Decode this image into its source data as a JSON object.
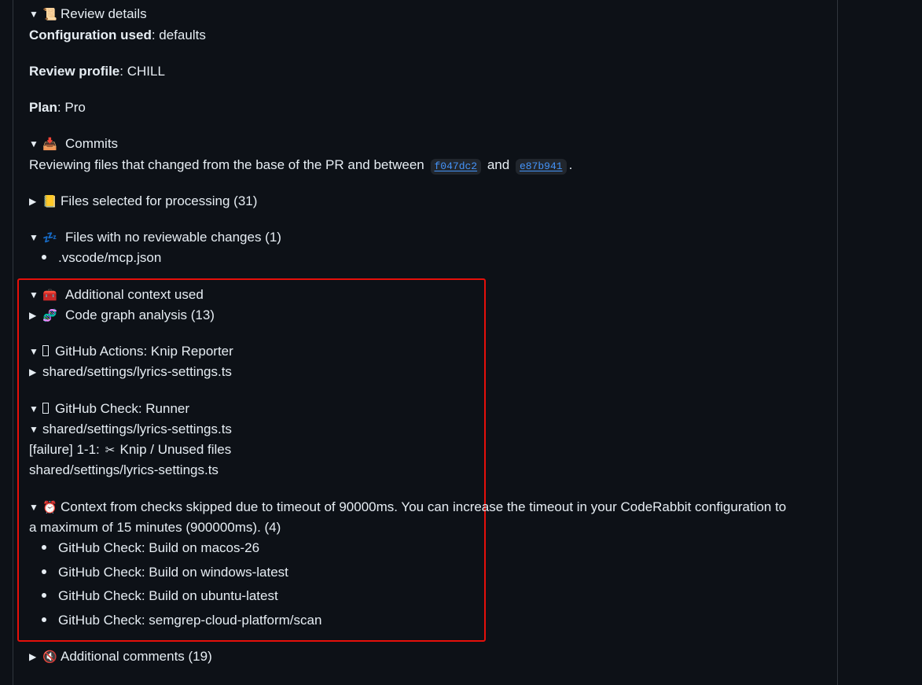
{
  "review_details": {
    "title": "Review details",
    "config_label": "Configuration used",
    "config_value": ": defaults",
    "profile_label": "Review profile",
    "profile_value": ": CHILL",
    "plan_label": "Plan",
    "plan_value": ": Pro"
  },
  "commits": {
    "title": "Commits",
    "text_prefix": "Reviewing files that changed from the base of the PR and between",
    "commit_from": "f047dc2",
    "text_mid": "and",
    "commit_to": "e87b941",
    "text_suffix": "."
  },
  "files_selected": {
    "title": "Files selected for processing (31)"
  },
  "files_no_changes": {
    "title": "Files with no reviewable changes (1)",
    "items": [
      ".vscode/mcp.json"
    ]
  },
  "additional_context": {
    "title": "Additional context used",
    "code_graph": "Code graph analysis (13)",
    "knip_reporter": "GitHub Actions: Knip Reporter",
    "knip_file": "shared/settings/lyrics-settings.ts",
    "runner": "GitHub Check: Runner",
    "runner_file": "shared/settings/lyrics-settings.ts",
    "failure_prefix": "[failure] 1-1:",
    "failure_text": "Knip / Unused files",
    "failure_path": "shared/settings/lyrics-settings.ts",
    "timeout_line1": "Context from checks skipped due to timeout of 90000ms. You can increase the timeout in your CodeRabbit configuration to",
    "timeout_line2": "a maximum of 15 minutes (900000ms). (4)",
    "timeout_items": [
      "GitHub Check: Build on macos-26",
      "GitHub Check: Build on windows-latest",
      "GitHub Check: Build on ubuntu-latest",
      "GitHub Check: semgrep-cloud-platform/scan"
    ]
  },
  "additional_comments": {
    "title": "Additional comments (19)"
  },
  "icons": {
    "review_details": "scroll-icon",
    "commits": "inbox-tray-icon",
    "files_selected": "ledger-icon",
    "no_changes": "zzz-icon",
    "context": "toolbox-icon",
    "code_graph": "dna-icon",
    "failure": "scissors-icon",
    "timeout": "alarm-clock-icon",
    "comments": "no-entry-icon"
  },
  "colors": {
    "background": "#0d1117",
    "text": "#e6edf3",
    "link": "#4493f8",
    "highlight_border": "#e5100a"
  }
}
